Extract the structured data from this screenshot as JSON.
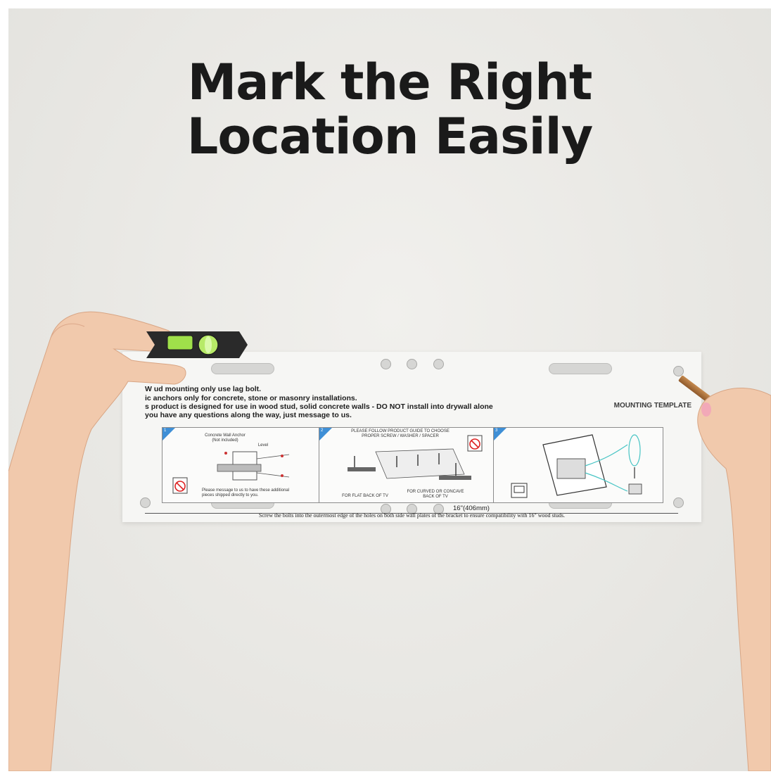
{
  "headline": {
    "line1": "Mark the Right",
    "line2": "Location Easily"
  },
  "template": {
    "title": "MOUNTING TEMPLATE",
    "instructions": [
      "W       ud mounting only use lag bolt.",
      "       ic anchors only for concrete, stone or masonry installations.",
      "       s product is designed for use in wood stud, solid concrete walls - DO NOT install into drywall alone",
      "       you have any questions along the way, just message to us."
    ],
    "panel1": {
      "label_anchor": "Concrete Wall Anchor (Not included)",
      "label_level": "Level",
      "note": "Please message to us to have these additional pieces shipped directly to you."
    },
    "panel2": {
      "heading": "PLEASE FOLLOW PRODUCT GUIDE TO CHOOSE PROPER SCREW / WASHER / SPACER",
      "caption_flat": "FOR FLAT BACK OF TV",
      "caption_curved": "FOR CURVED OR CONCAVE BACK OF TV"
    },
    "panel_numbers": [
      "1",
      "2",
      "3"
    ],
    "measurement": "16\"(406mm)",
    "footer": "Screw the bolts into the outermost edge of the holes on both side wall plates of the bracket to ensure compatibility with 16\" wood studs."
  },
  "colors": {
    "headline": "#1a1a1a",
    "wall": "#ebeae6",
    "level_body": "#2a2a2a",
    "level_bubble": "#9fe04a",
    "panel_accent": "#3f8fd6"
  }
}
